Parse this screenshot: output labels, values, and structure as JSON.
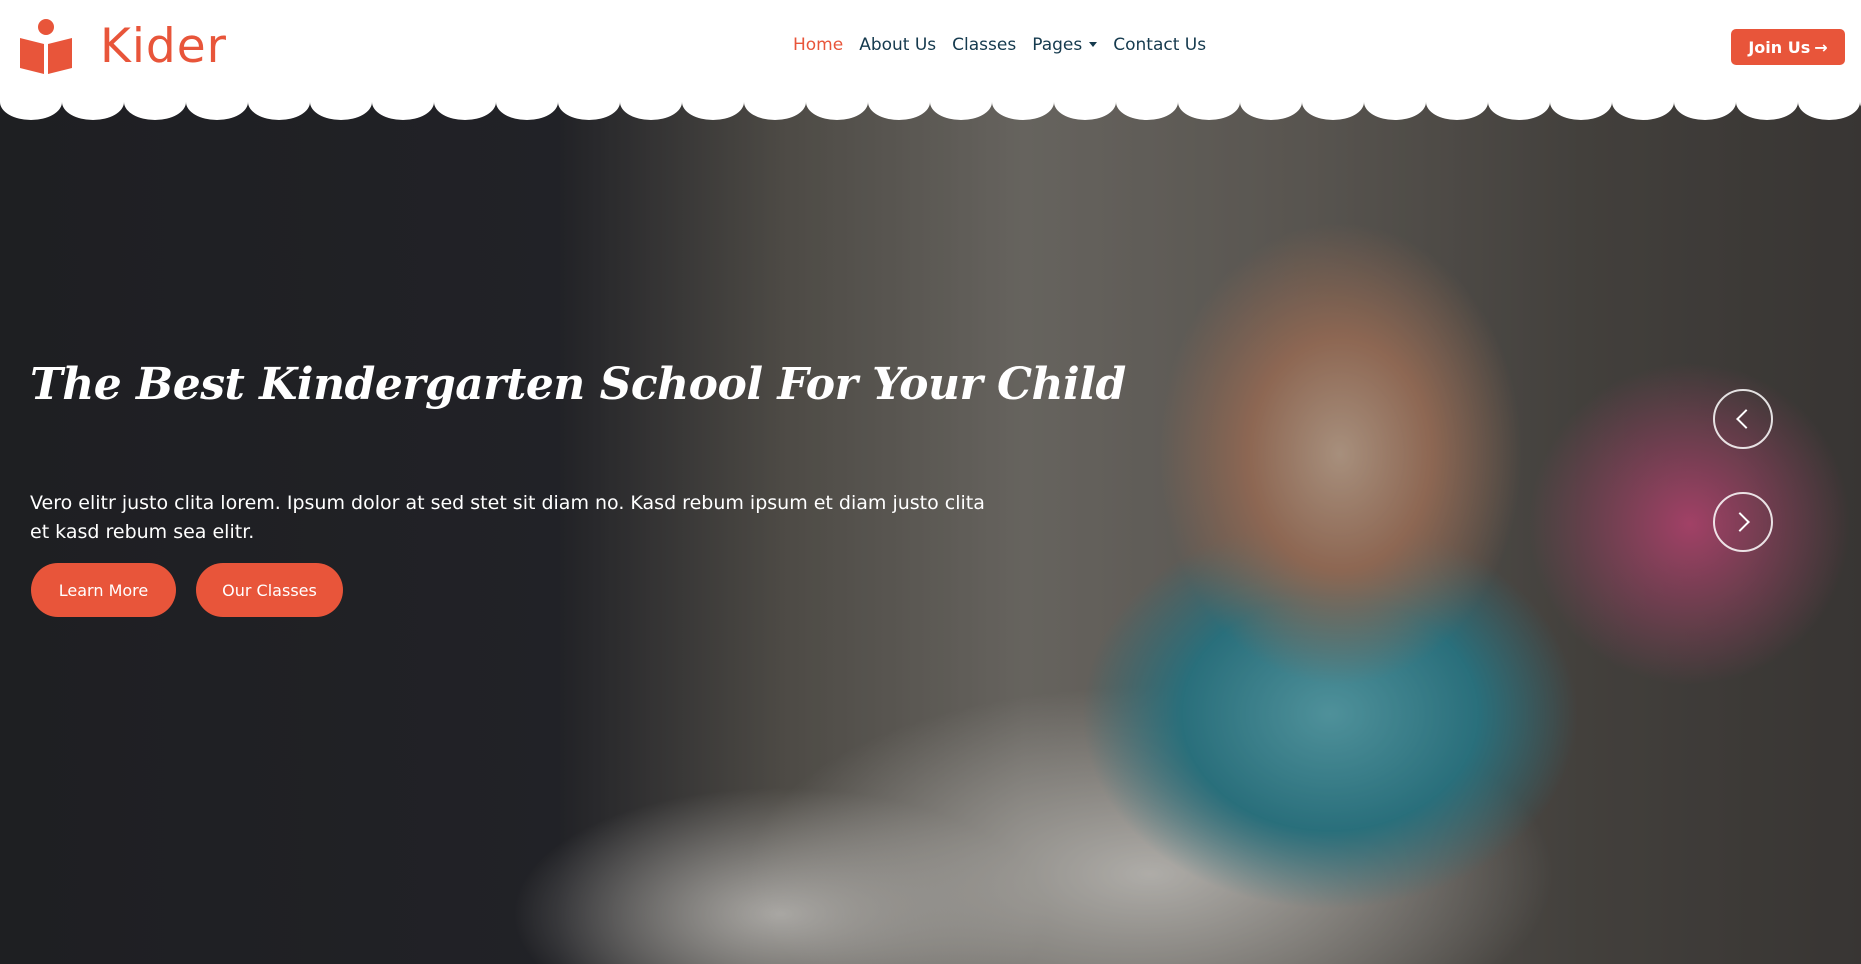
{
  "brand": {
    "name": "Kider",
    "logo_icon": "book-reader-icon",
    "accent_color": "#e8553a"
  },
  "nav": {
    "items": [
      {
        "label": "Home",
        "active": true
      },
      {
        "label": "About Us",
        "active": false
      },
      {
        "label": "Classes",
        "active": false
      },
      {
        "label": "Pages",
        "active": false,
        "dropdown": true
      },
      {
        "label": "Contact Us",
        "active": false
      }
    ],
    "join_label": "Join Us",
    "join_icon": "arrow-right-icon"
  },
  "hero": {
    "title": "The Best Kindergarten School For Your Child",
    "text": "Vero elitr justo clita lorem. Ipsum dolor at sed stet sit diam no. Kasd rebum ipsum et diam justo clita et kasd rebum sea elitr.",
    "buttons": [
      "Learn More",
      "Our Classes"
    ],
    "carousel": {
      "prev_icon": "chevron-left-icon",
      "next_icon": "chevron-right-icon"
    },
    "background": "photo of a toddler reading a picture book"
  },
  "colors": {
    "primary": "#e8553a",
    "nav_text": "#153a4e"
  }
}
